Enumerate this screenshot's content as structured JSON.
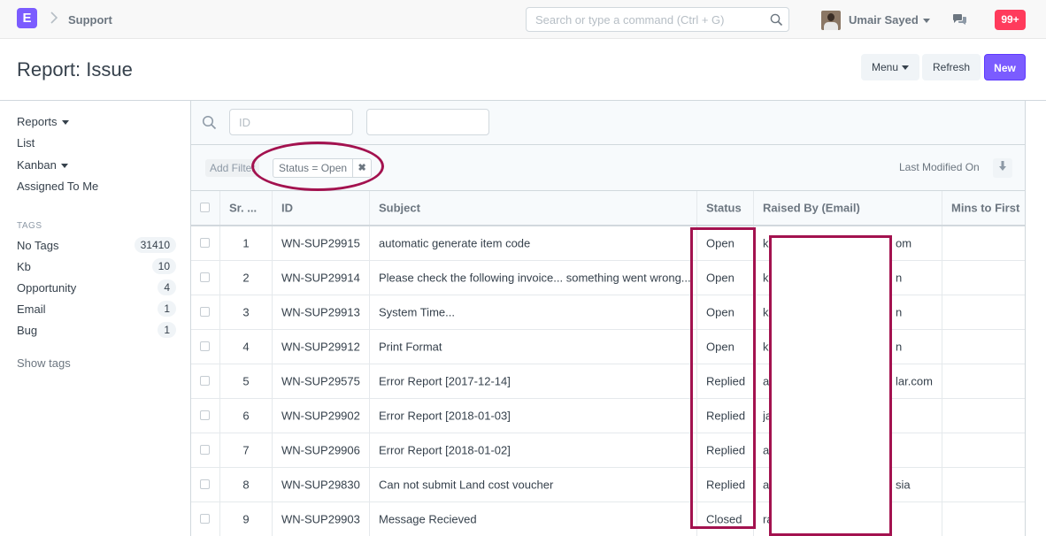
{
  "navbar": {
    "logo_letter": "E",
    "breadcrumb": "Support",
    "search_placeholder": "Search or type a command (Ctrl + G)",
    "user_name": "Umair Sayed",
    "notifications": "99+"
  },
  "page": {
    "title": "Report: Issue",
    "menu_label": "Menu",
    "refresh_label": "Refresh",
    "new_label": "New"
  },
  "sidebar": {
    "items": [
      {
        "label": "Reports",
        "dropdown": true
      },
      {
        "label": "List",
        "dropdown": false
      },
      {
        "label": "Kanban",
        "dropdown": true
      },
      {
        "label": "Assigned To Me",
        "dropdown": false
      }
    ],
    "tags_heading": "TAGS",
    "tags": [
      {
        "label": "No Tags",
        "count": "31410"
      },
      {
        "label": "Kb",
        "count": "10"
      },
      {
        "label": "Opportunity",
        "count": "4"
      },
      {
        "label": "Email",
        "count": "1"
      },
      {
        "label": "Bug",
        "count": "1"
      }
    ],
    "show_tags": "Show tags"
  },
  "filters": {
    "id_placeholder": "ID",
    "second_value": "",
    "add_filter": "Add Filter",
    "active_filter": "Status = Open",
    "sort_label": "Last Modified On"
  },
  "grid": {
    "columns": [
      "",
      "Sr. ...",
      "ID",
      "Subject",
      "Status",
      "Raised By (Email)",
      "Mins to First R"
    ],
    "rows": [
      {
        "sr": "1",
        "id": "WN-SUP29915",
        "subject": "automatic generate item code",
        "status": "Open",
        "email_start": "k",
        "email_end": "om"
      },
      {
        "sr": "2",
        "id": "WN-SUP29914",
        "subject": "Please check the following invoice... something went wrong...",
        "status": "Open",
        "email_start": "k",
        "email_end": "n"
      },
      {
        "sr": "3",
        "id": "WN-SUP29913",
        "subject": "System Time...",
        "status": "Open",
        "email_start": "k",
        "email_end": "n"
      },
      {
        "sr": "4",
        "id": "WN-SUP29912",
        "subject": "Print Format",
        "status": "Open",
        "email_start": "k",
        "email_end": "n"
      },
      {
        "sr": "5",
        "id": "WN-SUP29575",
        "subject": "Error Report [2017-12-14]",
        "status": "Replied",
        "email_start": "a",
        "email_end": "lar.com"
      },
      {
        "sr": "6",
        "id": "WN-SUP29902",
        "subject": "Error Report [2018-01-03]",
        "status": "Replied",
        "email_start": "ja",
        "email_end": ""
      },
      {
        "sr": "7",
        "id": "WN-SUP29906",
        "subject": "Error Report [2018-01-02]",
        "status": "Replied",
        "email_start": "a",
        "email_end": ""
      },
      {
        "sr": "8",
        "id": "WN-SUP29830",
        "subject": "Can not submit Land cost voucher",
        "status": "Replied",
        "email_start": "a",
        "email_end": "sia"
      },
      {
        "sr": "9",
        "id": "WN-SUP29903",
        "subject": "Message Recieved",
        "status": "Closed",
        "email_start": "ra",
        "email_end": ""
      }
    ]
  },
  "colors": {
    "accent": "#7b5cff",
    "notification": "#ff3b5c",
    "annotation": "#a3124f"
  }
}
